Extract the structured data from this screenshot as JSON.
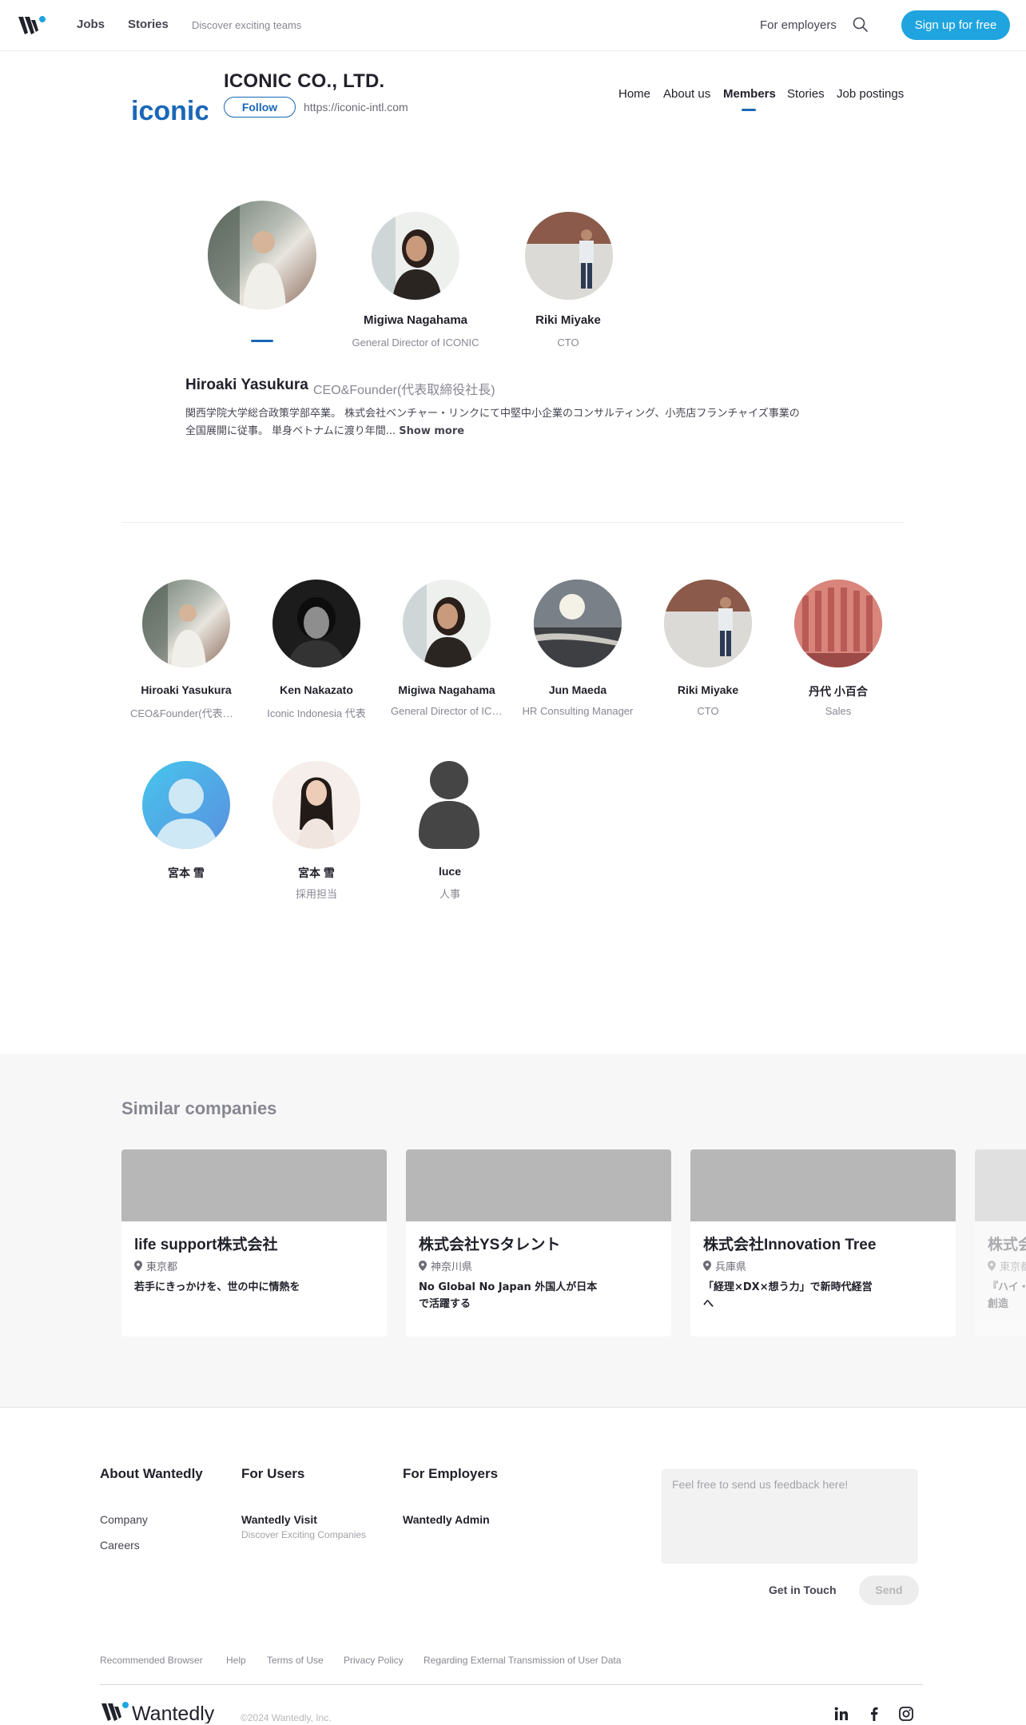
{
  "header": {
    "nav_jobs": "Jobs",
    "nav_stories": "Stories",
    "tagline": "Discover exciting teams",
    "for_employers": "For employers",
    "signup": "Sign up for free",
    "icons": {
      "logo": "wantedly-w-logo",
      "search": "search-icon"
    },
    "accent_color": "#1fa4df"
  },
  "company": {
    "logo_text": "iconic",
    "name": "ICONIC CO., LTD.",
    "follow": "Follow",
    "url": "https://iconic-intl.com",
    "tabs": [
      "Home",
      "About us",
      "Members",
      "Stories",
      "Job postings"
    ],
    "active_tab": "Members",
    "brand_color": "#1a67b8"
  },
  "featured": {
    "members": [
      {
        "name": "",
        "role": ""
      },
      {
        "name": "Migiwa Nagahama",
        "role": "General Director of ICONIC"
      },
      {
        "name": "Riki Miyake",
        "role": "CTO"
      }
    ],
    "selected": {
      "name": "Hiroaki Yasukura",
      "role": "CEO&Founder(代表取締役社長)",
      "bio_line1": "関西学院大学総合政策学部卒業。 株式会社ベンチャー・リンクにて中堅中小企業のコンサルティング、小売店フランチャイズ事業の",
      "bio_line2": "全国展開に従事。 単身ベトナムに渡り年間...",
      "show_more": "Show more"
    }
  },
  "members": [
    {
      "name": "Hiroaki Yasukura",
      "role": "CEO&Founder(代表取締役社長)"
    },
    {
      "name": "Ken Nakazato",
      "role": "Iconic Indonesia 代表"
    },
    {
      "name": "Migiwa Nagahama",
      "role": "General Director of ICONIC"
    },
    {
      "name": "Jun Maeda",
      "role": "HR Consulting Manager"
    },
    {
      "name": "Riki Miyake",
      "role": "CTO"
    },
    {
      "name": "丹代 小百合",
      "role": "Sales"
    },
    {
      "name": "宮本 雪",
      "role": ""
    },
    {
      "name": "宮本 雪",
      "role": "採用担当"
    },
    {
      "name": "luce",
      "role": "人事"
    }
  ],
  "similar": {
    "title": "Similar companies",
    "cards": [
      {
        "name": "life support株式会社",
        "location": "東京都",
        "desc1": "若手にきっかけを、世の中に情熱を",
        "desc2": ""
      },
      {
        "name": "株式会社YSタレント",
        "location": "神奈川県",
        "desc1": "No Global No Japan 外国人が日本",
        "desc2": "で活躍する"
      },
      {
        "name": "株式会社Innovation Tree",
        "location": "兵庫県",
        "desc1": "「経理×DX×想う力」で新時代経営",
        "desc2": "へ"
      },
      {
        "name": "株式会社",
        "location": "東京都",
        "desc1": "『ハイ・",
        "desc2": "創造"
      }
    ]
  },
  "footer": {
    "about_title": "About Wantedly",
    "about_links": [
      "Company",
      "Careers"
    ],
    "users_title": "For Users",
    "users_link": "Wantedly Visit",
    "users_sub": "Discover Exciting Companies",
    "employers_title": "For Employers",
    "employers_link": "Wantedly Admin",
    "feedback_placeholder": "Feel free to send us feedback here!",
    "get_in_touch": "Get in Touch",
    "send": "Send",
    "legal": [
      "Recommended Browser",
      "Help",
      "Terms of Use",
      "Privacy Policy",
      "Regarding External Transmission of User Data"
    ],
    "brand": "Wantedly",
    "copyright": "©2024 Wantedly, Inc.",
    "social_icons": [
      "linkedin-icon",
      "facebook-icon",
      "instagram-icon"
    ]
  }
}
